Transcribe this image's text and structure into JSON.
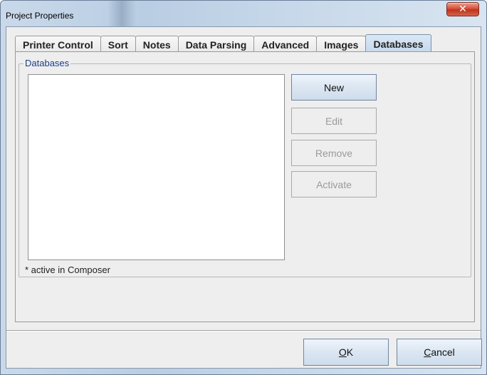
{
  "window": {
    "title": "Project Properties",
    "close_glyph": "✕"
  },
  "tabs": [
    {
      "label": "Printer Control",
      "active": false
    },
    {
      "label": "Sort",
      "active": false
    },
    {
      "label": "Notes",
      "active": false
    },
    {
      "label": "Data Parsing",
      "active": false
    },
    {
      "label": "Advanced",
      "active": false
    },
    {
      "label": "Images",
      "active": false
    },
    {
      "label": "Databases",
      "active": true
    }
  ],
  "databases": {
    "group_title": "Databases",
    "footnote": "* active in Composer",
    "buttons": {
      "new": "New",
      "edit": "Edit",
      "remove": "Remove",
      "activate": "Activate"
    }
  },
  "dialog": {
    "ok_mnemonic": "O",
    "ok_rest": "K",
    "cancel_mnemonic": "C",
    "cancel_rest": "ancel"
  },
  "colors": {
    "group_title": "#1d3e8a",
    "close_button": "#c0321c",
    "active_tab": "#c6d8ec"
  }
}
